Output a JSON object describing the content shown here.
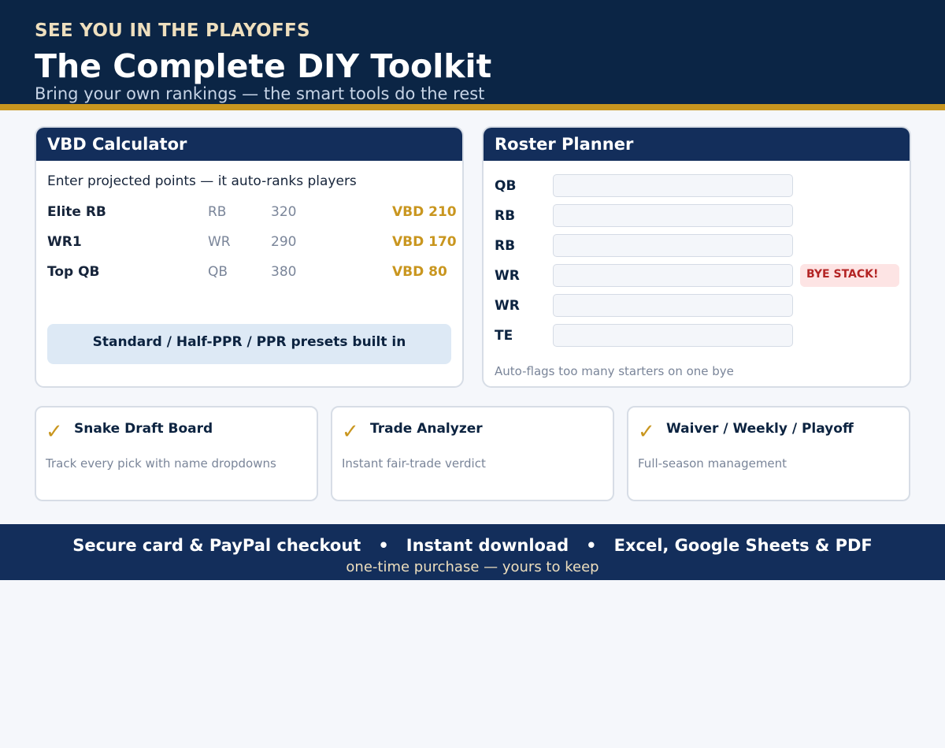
{
  "hero": {
    "eyebrow": "SEE YOU IN THE PLAYOFFS",
    "title": "The Complete DIY Toolkit",
    "subtitle": "Bring your own rankings — the smart tools do the rest"
  },
  "vbd": {
    "title": "VBD Calculator",
    "note": "Enter projected points — it auto-ranks players",
    "rows": [
      {
        "name": "Elite RB",
        "pos": "RB",
        "pts": "320",
        "vbd": "VBD 210"
      },
      {
        "name": "WR1",
        "pos": "WR",
        "pts": "290",
        "vbd": "VBD 170"
      },
      {
        "name": "Top QB",
        "pos": "QB",
        "pts": "380",
        "vbd": "VBD 80"
      }
    ],
    "presets": "Standard / Half-PPR / PPR presets built in"
  },
  "roster": {
    "title": "Roster Planner",
    "slots": [
      {
        "label": "QB",
        "value": ""
      },
      {
        "label": "RB",
        "value": ""
      },
      {
        "label": "RB",
        "value": ""
      },
      {
        "label": "WR",
        "value": "",
        "badge": "BYE STACK!"
      },
      {
        "label": "WR",
        "value": ""
      },
      {
        "label": "TE",
        "value": ""
      }
    ],
    "note": "Auto-flags too many starters on one bye"
  },
  "features": [
    {
      "icon": "check-icon",
      "check": "✓",
      "title": "Snake Draft Board",
      "desc": "Track every pick with name dropdowns"
    },
    {
      "icon": "check-icon",
      "check": "✓",
      "title": "Trade Analyzer",
      "desc": "Instant fair-trade verdict"
    },
    {
      "icon": "check-icon",
      "check": "✓",
      "title": "Waiver / Weekly / Playoff",
      "desc": "Full-season management"
    }
  ],
  "footer": {
    "items": [
      "Secure card & PayPal checkout",
      "Instant download",
      "Excel, Google Sheets & PDF"
    ],
    "separator": "•",
    "sub": "one-time purchase — yours to keep"
  },
  "colors": {
    "navy": "#0b2545",
    "header_navy": "#132e5b",
    "gold": "#c9961f",
    "cream": "#eedfbe",
    "alert_bg": "#fde4e4",
    "alert_text": "#b32424"
  }
}
